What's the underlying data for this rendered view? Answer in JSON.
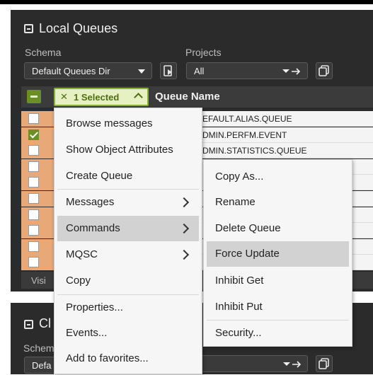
{
  "local_queues": {
    "title": "Local Queues",
    "schema_label": "Schema",
    "schema_value": "Default Queues Dir",
    "projects_label": "Projects",
    "projects_value": "All"
  },
  "table": {
    "selected_label": "1 Selected",
    "column_header": "Queue Name",
    "rows": [
      {
        "name": "EFAULT.ALIAS.QUEUE",
        "checked": false
      },
      {
        "name": "DMIN.PERFM.EVENT",
        "checked": true
      },
      {
        "name": "DMIN.STATISTICS.QUEUE",
        "checked": false
      },
      {
        "name": "",
        "checked": false
      },
      {
        "name": "",
        "checked": false
      },
      {
        "name": "",
        "checked": false
      },
      {
        "name": "",
        "checked": false
      },
      {
        "name": "",
        "checked": false
      },
      {
        "name": "",
        "checked": false
      },
      {
        "name": "",
        "checked": false
      }
    ],
    "footer_text": "Visi"
  },
  "context_menu": {
    "items": [
      "Browse messages",
      "Show Object Attributes",
      "Create Queue",
      "Messages",
      "Commands",
      "MQSC",
      "Copy",
      "Properties...",
      "Events...",
      "Add to favorites..."
    ]
  },
  "submenu": {
    "items": [
      "Copy As...",
      "Rename",
      "Delete Queue",
      "Force Update",
      "Inhibit Get",
      "Inhibit Put",
      "Security..."
    ]
  },
  "cluster_panel": {
    "title": "Cl",
    "schema_label": "Schem",
    "schema_value": "Defa"
  },
  "colors": {
    "accent_green": "#6a8f24",
    "row_left": "#e9a877",
    "panel_bg": "#2b2b2b",
    "highlight": "#d2d2d2"
  }
}
